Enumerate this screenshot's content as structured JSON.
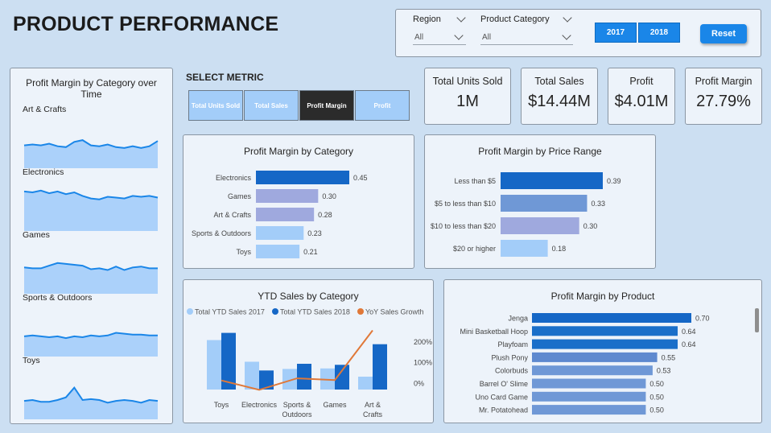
{
  "page_title": "PRODUCT PERFORMANCE",
  "filters": {
    "region_label": "Region",
    "region_value": "All",
    "category_label": "Product Category",
    "category_value": "All",
    "year_buttons": [
      "2017",
      "2018"
    ],
    "reset_label": "Reset"
  },
  "select_metric": {
    "label": "SELECT METRIC",
    "buttons": [
      "Total Units Sold",
      "Total Sales",
      "Profit Margin",
      "Profit"
    ],
    "selected": "Profit Margin"
  },
  "kpis": [
    {
      "label": "Total Units Sold",
      "value": "1M"
    },
    {
      "label": "Total Sales",
      "value": "$14.44M"
    },
    {
      "label": "Profit",
      "value": "$4.01M"
    },
    {
      "label": "Profit Margin",
      "value": "27.79%"
    }
  ],
  "colors": {
    "dark_blue": "#1567c6",
    "mid_blue": "#6f98d6",
    "lavender": "#9fa9de",
    "light_blue": "#a3cdf9",
    "orange": "#e07838",
    "selected_button": "#2b2b2b"
  },
  "chart_data": [
    {
      "type": "area",
      "title": "Profit Margin by Category over Time",
      "small_multiples": [
        "Art & Crafts",
        "Electronics",
        "Games",
        "Sports & Outdoors",
        "Toys"
      ],
      "series": [
        {
          "name": "Art & Crafts",
          "values": [
            0.26,
            0.27,
            0.26,
            0.28,
            0.25,
            0.24,
            0.3,
            0.32,
            0.26,
            0.25,
            0.27,
            0.24,
            0.23,
            0.25,
            0.23,
            0.25,
            0.31
          ]
        },
        {
          "name": "Electronics",
          "values": [
            0.45,
            0.44,
            0.46,
            0.43,
            0.45,
            0.42,
            0.44,
            0.4,
            0.37,
            0.36,
            0.39,
            0.38,
            0.37,
            0.4,
            0.39,
            0.4,
            0.38
          ]
        },
        {
          "name": "Games",
          "values": [
            0.3,
            0.29,
            0.29,
            0.32,
            0.35,
            0.34,
            0.33,
            0.32,
            0.28,
            0.29,
            0.27,
            0.31,
            0.27,
            0.3,
            0.31,
            0.29,
            0.29
          ]
        },
        {
          "name": "Sports & Outdoors",
          "values": [
            0.23,
            0.24,
            0.23,
            0.22,
            0.23,
            0.21,
            0.23,
            0.22,
            0.24,
            0.23,
            0.24,
            0.27,
            0.26,
            0.25,
            0.25,
            0.24,
            0.24
          ]
        },
        {
          "name": "Toys",
          "values": [
            0.21,
            0.22,
            0.2,
            0.2,
            0.22,
            0.25,
            0.36,
            0.22,
            0.23,
            0.22,
            0.19,
            0.21,
            0.22,
            0.21,
            0.19,
            0.22,
            0.21
          ]
        }
      ]
    },
    {
      "type": "bar",
      "title": "Profit Margin by Category",
      "categories": [
        "Electronics",
        "Games",
        "Art & Crafts",
        "Sports & Outdoors",
        "Toys"
      ],
      "values": [
        0.45,
        0.3,
        0.28,
        0.23,
        0.21
      ],
      "labels": [
        "0.45",
        "0.30",
        "0.28",
        "0.23",
        "0.21"
      ],
      "bar_colors": [
        "#1567c6",
        "#9fa9de",
        "#9fa9de",
        "#a3cdf9",
        "#a3cdf9"
      ],
      "xlim": [
        0,
        0.45
      ]
    },
    {
      "type": "bar",
      "title": "Profit Margin by Price Range",
      "categories": [
        "Less than $5",
        "$5 to less than $10",
        "$10 to less than $20",
        "$20 or higher"
      ],
      "values": [
        0.39,
        0.33,
        0.3,
        0.18
      ],
      "labels": [
        "0.39",
        "0.33",
        "0.30",
        "0.18"
      ],
      "bar_colors": [
        "#1567c6",
        "#6f98d6",
        "#9fa9de",
        "#a3cdf9"
      ],
      "xlim": [
        0,
        0.39
      ]
    },
    {
      "type": "bar",
      "title": "YTD Sales by Category",
      "categories": [
        "Toys",
        "Electronics",
        "Sports & Outdoors",
        "Games",
        "Art & Crafts"
      ],
      "series": [
        {
          "name": "Total YTD Sales 2017",
          "values": [
            0.96,
            0.54,
            0.4,
            0.41,
            0.25
          ],
          "color": "#a3cdf9"
        },
        {
          "name": "Total YTD Sales 2018",
          "values": [
            1.1,
            0.37,
            0.5,
            0.48,
            0.88
          ],
          "color": "#1567c6"
        },
        {
          "name": "YoY Sales Growth",
          "values": [
            0.15,
            -0.3,
            0.25,
            0.17,
            2.55
          ],
          "color": "#e07838",
          "type": "line"
        }
      ],
      "y2_ticks": [
        "0%",
        "100%",
        "200%"
      ],
      "y2lim": [
        -0.4,
        2.8
      ],
      "legend": "top"
    },
    {
      "type": "bar",
      "title": "Profit Margin by Product",
      "categories": [
        "Jenga",
        "Mini Basketball Hoop",
        "Playfoam",
        "Plush Pony",
        "Colorbuds",
        "Barrel O' Slime",
        "Uno Card Game",
        "Mr. Potatohead"
      ],
      "values": [
        0.7,
        0.64,
        0.64,
        0.55,
        0.53,
        0.5,
        0.5,
        0.5
      ],
      "labels": [
        "0.70",
        "0.64",
        "0.64",
        "0.55",
        "0.53",
        "0.50",
        "0.50",
        "0.50"
      ],
      "bar_colors": [
        "#1567c6",
        "#1a6fc9",
        "#1a6fc9",
        "#5e89cf",
        "#6f98d6",
        "#6f98d6",
        "#6f98d6",
        "#6f98d6"
      ],
      "xlim": [
        0,
        0.7
      ]
    }
  ]
}
